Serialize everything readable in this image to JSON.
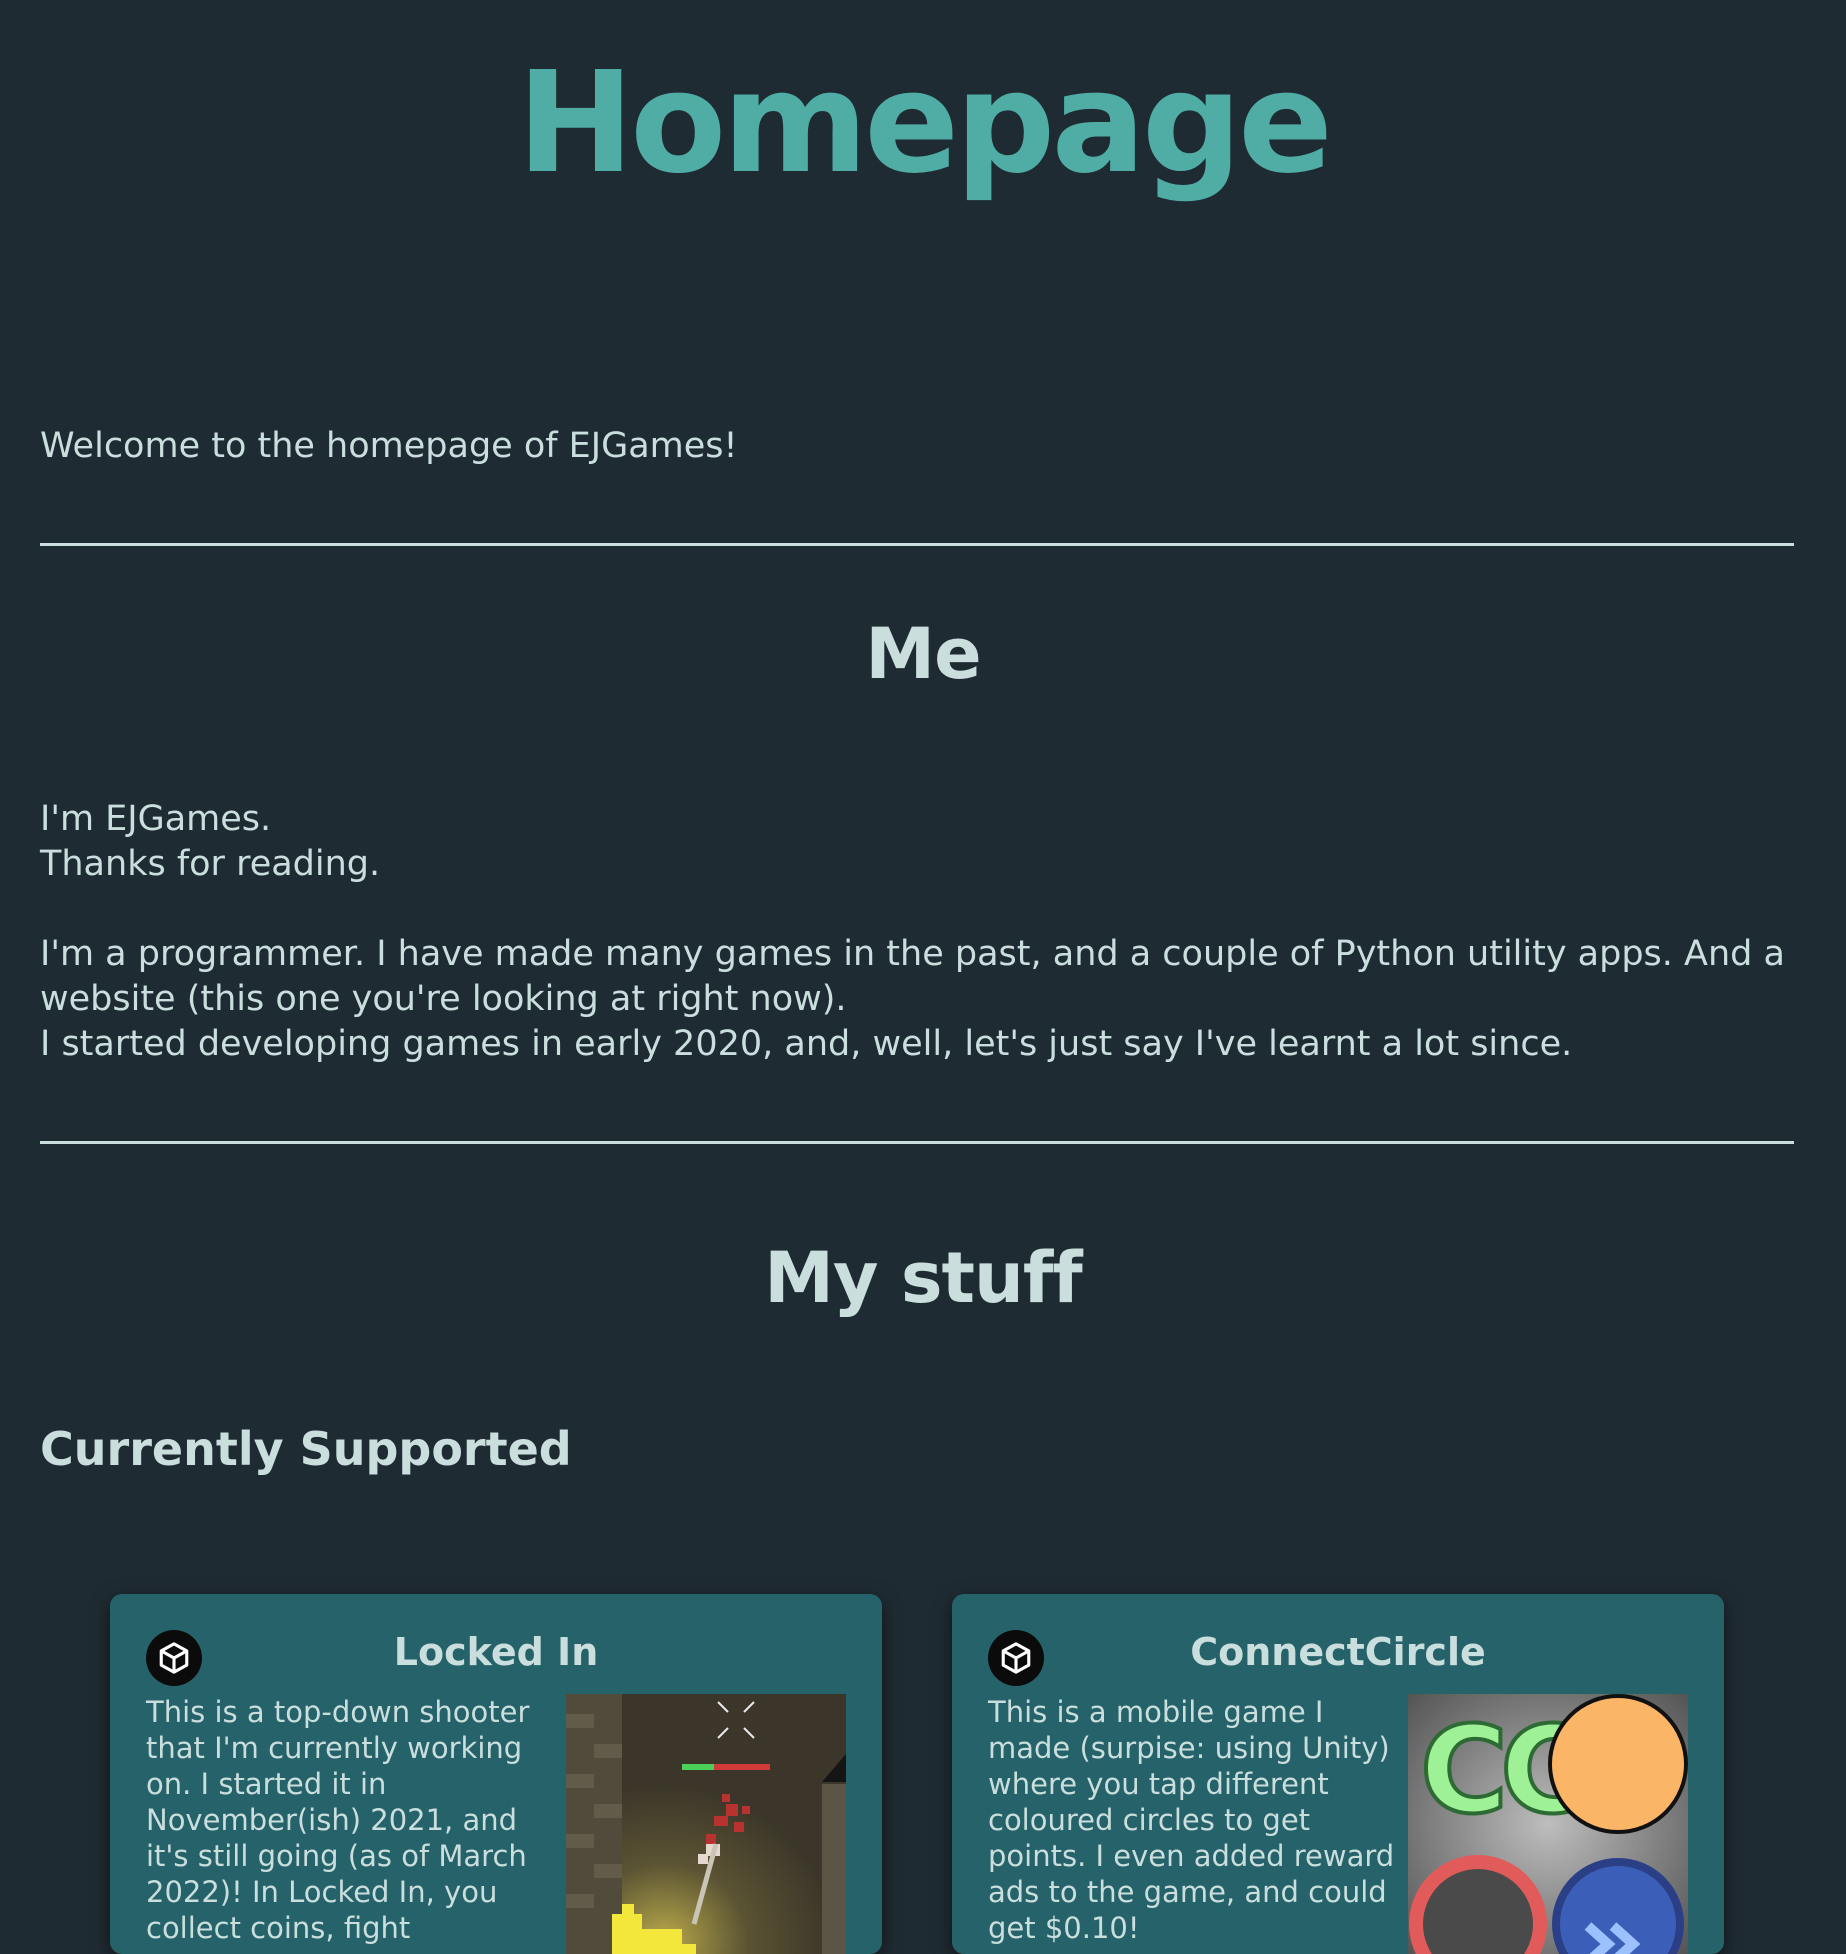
{
  "page": {
    "title": "Homepage",
    "welcome": "Welcome to the homepage of EJGames!"
  },
  "me": {
    "heading": "Me",
    "line1": "I'm EJGames.",
    "line2": "Thanks for reading.",
    "para1": "I'm a programmer. I have made many games in the past, and a couple of Python utility apps. And a website (this one you're looking at right now).",
    "para2": "I started developing games in early 2020, and, well, let's just say I've learnt a lot since."
  },
  "stuff": {
    "heading": "My stuff",
    "subheading": "Currently Supported",
    "cards": [
      {
        "title": "Locked In",
        "engine_icon": "unity-icon",
        "description": "This is a top-down shooter that I'm currently working on. I started it in November(ish) 2021, and it's still going (as of March 2022)! In Locked In, you collect coins, fight"
      },
      {
        "title": "ConnectCircle",
        "engine_icon": "unity-icon",
        "description": "This is a mobile game I made (surpise: using Unity) where you tap different coloured circles to get points. I even added reward ads to the game, and could get $0.10!",
        "logo_text": "CC"
      }
    ]
  },
  "colors": {
    "background": "#1f2b32",
    "accent": "#4fada6",
    "text": "#c9dedd",
    "card": "#256269"
  }
}
